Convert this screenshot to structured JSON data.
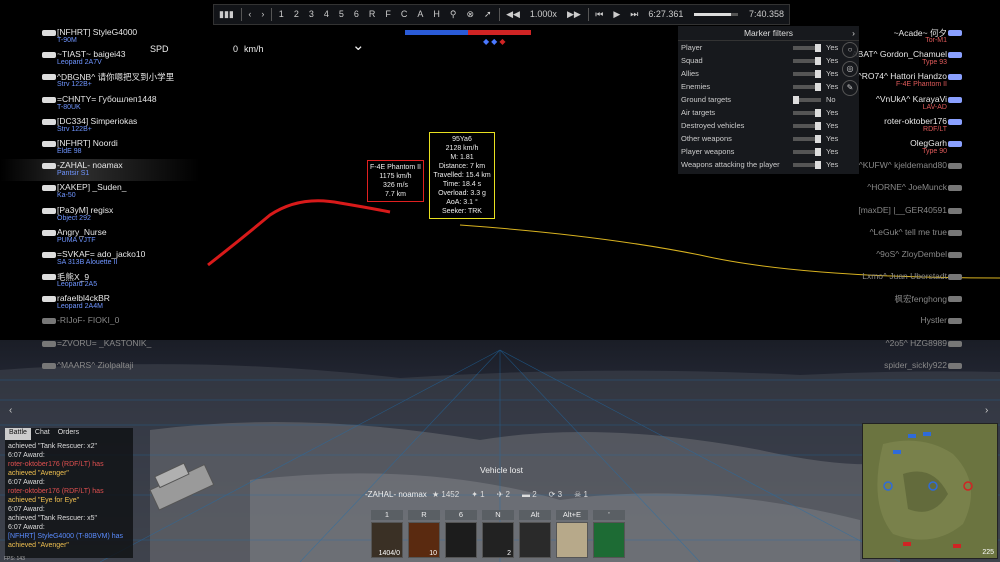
{
  "replay": {
    "controls": [
      "⏮",
      "‹",
      "›",
      "1",
      "2",
      "3",
      "4",
      "5",
      "6",
      "R",
      "F",
      "C",
      "A",
      "H"
    ],
    "icons": [
      "marker-pin-icon",
      "cross-circle-icon",
      "cursor-icon",
      "speed-back-icon"
    ],
    "speed": "1.000x",
    "current_time": "6:27.361",
    "total_time": "7:40.358",
    "progress": 0.84
  },
  "hud": {
    "spd_label": "SPD",
    "spd_value": "0",
    "spd_unit": "km/h",
    "vehicle_lost": "Vehicle lost",
    "player_name": "-ZAHAL- noamax",
    "stats": [
      "1452",
      "1",
      "2",
      "2",
      "3",
      "1"
    ]
  },
  "team_left": [
    {
      "name": "[NFHRT] StyleG4000",
      "vehicle": "T-90M",
      "dead": false
    },
    {
      "name": "~TIAST~ baigei43",
      "vehicle": "Leopard 2A7V",
      "dead": false
    },
    {
      "name": "^DBGNB^ 请你嗯把叉到小学里",
      "vehicle": "Strv 122B+",
      "dead": false
    },
    {
      "name": "=CHNTY= Губошлеп1448",
      "vehicle": "T-80UK",
      "dead": false
    },
    {
      "name": "[DC334] Simperiokas",
      "vehicle": "Strv 122B+",
      "dead": false
    },
    {
      "name": "[NFHRT] Noordi",
      "vehicle": "EldE 98",
      "dead": false
    },
    {
      "name": "-ZAHAL- noamax",
      "vehicle": "Pantsir S1",
      "dead": false,
      "highlight": true
    },
    {
      "name": "[XAKEP] _Suden_",
      "vehicle": "Ka-50",
      "dead": false
    },
    {
      "name": "[Pa3yM] regisx",
      "vehicle": "Object 292",
      "dead": false
    },
    {
      "name": "Angry_Nurse",
      "vehicle": "PUMA VJTF",
      "dead": false
    },
    {
      "name": "=SVKAF= ado_jacko10",
      "vehicle": "SA 313B Alouette II",
      "dead": false
    },
    {
      "name": "毛熊X_9",
      "vehicle": "Leopard 2A5",
      "dead": false
    },
    {
      "name": "rafaelbl4ckBR",
      "vehicle": "Leopard 2A4M",
      "dead": false
    },
    {
      "name": "-RIJoF- FIOKI_0",
      "vehicle": "",
      "dead": true
    },
    {
      "name": "=ZVORU= _KASTONIK_",
      "vehicle": "",
      "dead": true
    },
    {
      "name": "^MAARS^ Ziolpaltaji",
      "vehicle": "",
      "dead": true
    }
  ],
  "team_right": [
    {
      "name": "~Acade~ 何夕",
      "vehicle": "Tor-M1",
      "dead": false
    },
    {
      "name": "ABAT^ Gordon_Chamuel",
      "vehicle": "Type 93",
      "dead": false
    },
    {
      "name": "^RO74^ Hattori Handzo",
      "vehicle": "F-4E Phantom II",
      "dead": false
    },
    {
      "name": "^VnUkA^ KarayaVi",
      "vehicle": "LAV-AD",
      "dead": false
    },
    {
      "name": "roter-oktober176",
      "vehicle": "RDF/LT",
      "dead": false
    },
    {
      "name": "OlegGarh",
      "vehicle": "Type 90",
      "dead": false
    },
    {
      "name": "^KUFW^ kjeldemand80",
      "vehicle": "",
      "dead": true
    },
    {
      "name": "^HORNE^ JoeMunck",
      "vehicle": "",
      "dead": true
    },
    {
      "name": "[maxDE] |__GER40591",
      "vehicle": "",
      "dead": true
    },
    {
      "name": "^LeGuk^ tell me true",
      "vehicle": "",
      "dead": true
    },
    {
      "name": "^9oS^ ZloyDembel",
      "vehicle": "",
      "dead": true
    },
    {
      "name": "Lxmo^ Juan Uberstadt",
      "vehicle": "",
      "dead": true
    },
    {
      "name": "枫宏fenghong",
      "vehicle": "",
      "dead": true
    },
    {
      "name": "Hystler",
      "vehicle": "",
      "dead": true
    },
    {
      "name": "^2o5^ HZG8989",
      "vehicle": "",
      "dead": true
    },
    {
      "name": "spider_sickly922",
      "vehicle": "",
      "dead": true
    }
  ],
  "marker_filters": {
    "title": "Marker filters",
    "rows": [
      {
        "label": "Player",
        "value": "Yes"
      },
      {
        "label": "Squad",
        "value": "Yes"
      },
      {
        "label": "Allies",
        "value": "Yes"
      },
      {
        "label": "Enemies",
        "value": "Yes"
      },
      {
        "label": "Ground targets",
        "value": "No"
      },
      {
        "label": "Air targets",
        "value": "Yes"
      },
      {
        "label": "Destroyed vehicles",
        "value": "Yes"
      },
      {
        "label": "Other weapons",
        "value": "Yes"
      },
      {
        "label": "Player weapons",
        "value": "Yes"
      },
      {
        "label": "Weapons attacking the player",
        "value": "Yes"
      }
    ]
  },
  "target_box": {
    "lines": [
      "F-4E Phantom II",
      "1175 km/h",
      "326 m/s",
      "7.7 km"
    ]
  },
  "missile_box": {
    "lines": [
      "95Ya6",
      "2128 km/h",
      "M: 1.81",
      "Distance: 7 km",
      "Travelled: 15.4 km",
      "Time: 18.4 s",
      "Overload: 3.3 g",
      "AoA: 3.1 °",
      "Seeker: TRK"
    ]
  },
  "chat": {
    "tabs": [
      "Battle",
      "Chat",
      "Orders"
    ],
    "lines": [
      {
        "text": "achieved \"Tank Rescuer: x2\"",
        "cls": ""
      },
      {
        "text": "6:07 Award:",
        "cls": ""
      },
      {
        "text": "roter-oktober176 (RDF/LT) has",
        "cls": "red"
      },
      {
        "text": "achieved \"Avenger\"",
        "cls": "yel"
      },
      {
        "text": "6:07 Award:",
        "cls": ""
      },
      {
        "text": "roter-oktober176 (RDF/LT) has",
        "cls": "red"
      },
      {
        "text": "achieved \"Eye for Eye\"",
        "cls": "yel"
      },
      {
        "text": "6:07 Award:",
        "cls": ""
      },
      {
        "text": "achieved \"Tank Rescuer: x5\"",
        "cls": ""
      },
      {
        "text": "6:07 Award:",
        "cls": ""
      },
      {
        "text": "[NFHRT] StyleG4000 (T-80BVM) has",
        "cls": "blue"
      },
      {
        "text": "achieved \"Avenger\"",
        "cls": "yel"
      }
    ]
  },
  "weapons": [
    {
      "key": "1",
      "count": "1404/0"
    },
    {
      "key": "R",
      "count": "10"
    },
    {
      "key": "6",
      "count": ""
    },
    {
      "key": "N",
      "count": "2"
    },
    {
      "key": "Alt",
      "count": ""
    },
    {
      "key": "Alt+E",
      "count": ""
    },
    {
      "key": "'",
      "count": ""
    }
  ],
  "minimap": {
    "scale": "225"
  },
  "fps": "FPS: 143"
}
